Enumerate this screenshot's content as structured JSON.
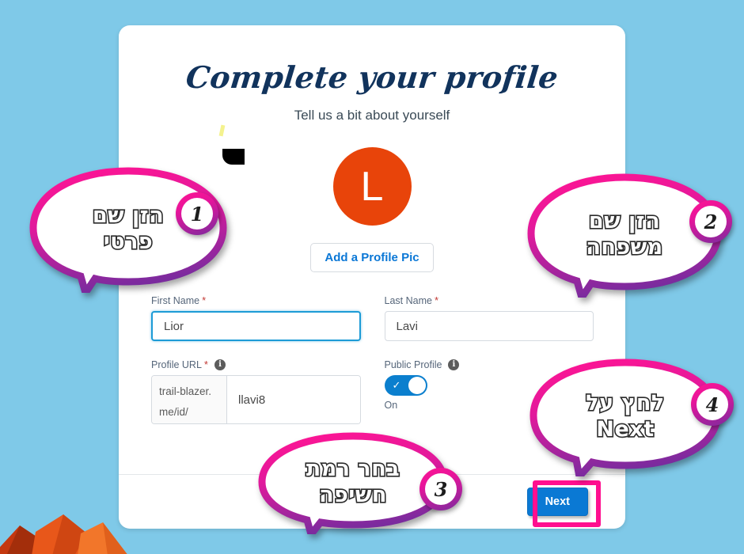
{
  "page": {
    "background_color": "#7fc9e8"
  },
  "card": {
    "title": "Complete your profile",
    "subtitle": "Tell us a bit about yourself",
    "avatar": {
      "initial": "L",
      "color": "#e8440a"
    },
    "profile_pic_button": "Add a Profile Pic",
    "fields": {
      "first_name": {
        "label": "First Name",
        "required_marker": "*",
        "value": "Lior",
        "focused": true
      },
      "last_name": {
        "label": "Last Name",
        "required_marker": "*",
        "value": "Lavi",
        "focused": false
      },
      "profile_url": {
        "label": "Profile URL",
        "required_marker": "*",
        "prefix": "trail-blazer.me/id/",
        "value": "llavi8",
        "info_icon": "info-icon"
      },
      "public_profile": {
        "label": "Public Profile",
        "info_icon": "info-icon",
        "state_label": "On",
        "checked": true,
        "accent_color": "#0b7fce"
      }
    },
    "footer": {
      "next_button": "Next",
      "next_button_color": "#0a79d4",
      "highlight_color": "#ff0f8f"
    }
  },
  "callouts": [
    {
      "id": "bubble-1",
      "lines": [
        "הזן שם",
        "פרטי"
      ],
      "badge": "1",
      "target": "first-name-input"
    },
    {
      "id": "bubble-2",
      "lines": [
        "הזן שם",
        "משפחה"
      ],
      "badge": "2",
      "target": "last-name-input"
    },
    {
      "id": "bubble-3",
      "lines": [
        "בחר רמת",
        "חשיפה"
      ],
      "badge": "3",
      "target": "public-profile-toggle"
    },
    {
      "id": "bubble-4",
      "lines": [
        "לחץ על",
        "Next"
      ],
      "badge": "4",
      "target": "next-button"
    }
  ]
}
